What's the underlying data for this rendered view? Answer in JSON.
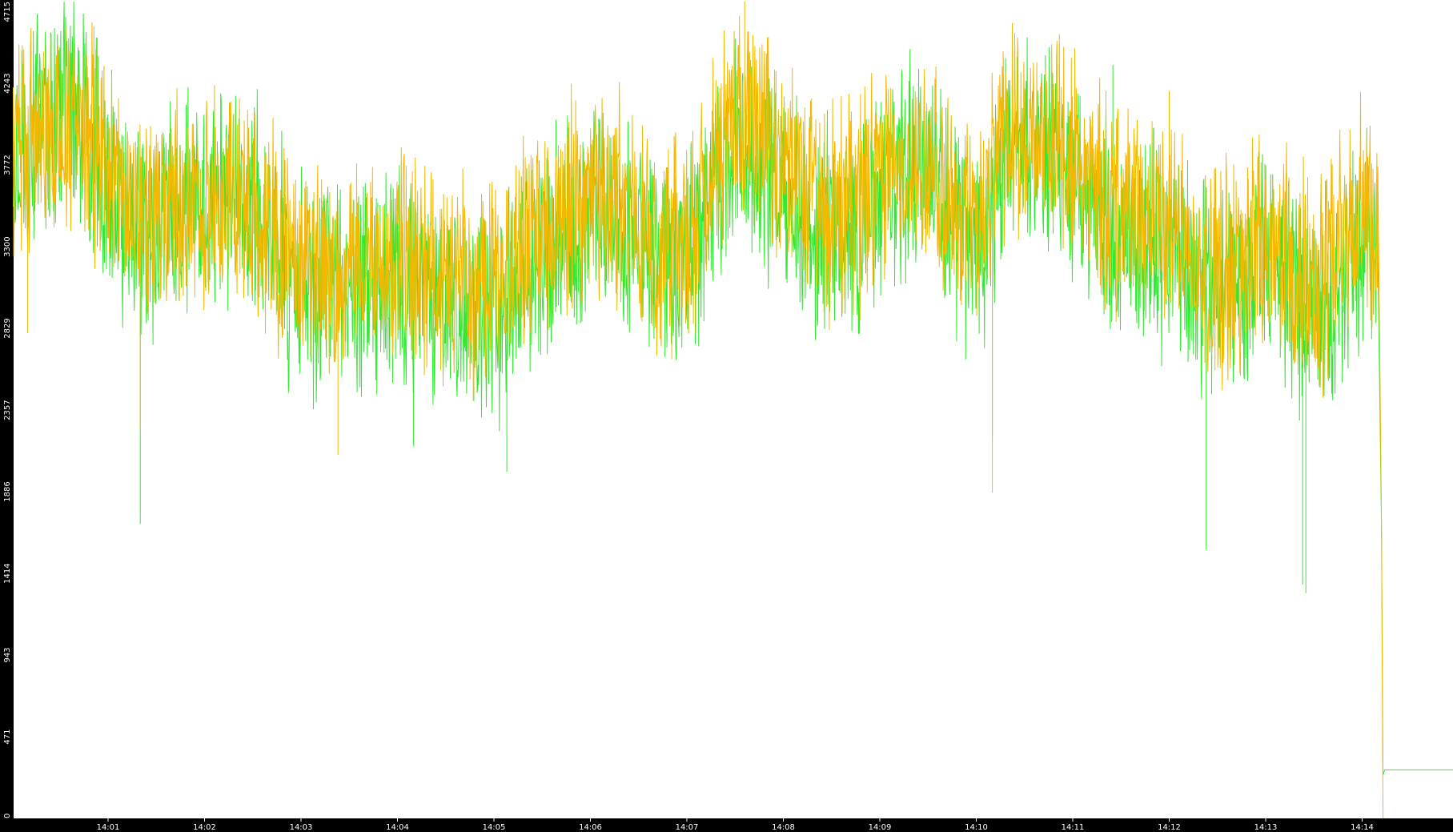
{
  "chart_data": {
    "type": "line",
    "title": "",
    "xlabel": "",
    "ylabel": "",
    "x_ticks": [
      "14:01",
      "14:02",
      "14:03",
      "14:04",
      "14:05",
      "14:06",
      "14:07",
      "14:08",
      "14:09",
      "14:10",
      "14:11",
      "14:12",
      "14:13",
      "14:14"
    ],
    "y_ticks": [
      "0",
      "471",
      "943",
      "1414",
      "1886",
      "2357",
      "2829",
      "3300",
      "3772",
      "4243",
      "4715"
    ],
    "ylim": [
      0,
      4715
    ],
    "xlim_minutes": [
      "14:00:01",
      "14:14:59"
    ],
    "grid": false,
    "legend": "none",
    "colors": {
      "background": "#ffffff",
      "frame": "#000000",
      "text": "#ffffff"
    },
    "series": [
      {
        "color": "#33e833",
        "trace": [
          [
            "14:00:01",
            3900
          ],
          [
            "14:00:40",
            4150
          ],
          [
            "14:01:00",
            3650
          ],
          [
            "14:01:20",
            3400
          ],
          [
            "14:01:40",
            3500
          ],
          [
            "14:02:00",
            3550
          ],
          [
            "14:02:30",
            3550
          ],
          [
            "14:03:00",
            3050
          ],
          [
            "14:03:30",
            3050
          ],
          [
            "14:04:00",
            3100
          ],
          [
            "14:04:30",
            3000
          ],
          [
            "14:05:00",
            2850
          ],
          [
            "14:05:30",
            3300
          ],
          [
            "14:06:00",
            3550
          ],
          [
            "14:06:30",
            3350
          ],
          [
            "14:07:00",
            3200
          ],
          [
            "14:07:30",
            3950
          ],
          [
            "14:08:00",
            3650
          ],
          [
            "14:08:30",
            3350
          ],
          [
            "14:09:00",
            3600
          ],
          [
            "14:09:30",
            3800
          ],
          [
            "14:10:00",
            3200
          ],
          [
            "14:10:20",
            3850
          ],
          [
            "14:10:50",
            3900
          ],
          [
            "14:11:00",
            3650
          ],
          [
            "14:11:30",
            3350
          ],
          [
            "14:12:00",
            3300
          ],
          [
            "14:12:30",
            3000
          ],
          [
            "14:13:00",
            3250
          ],
          [
            "14:13:30",
            2850
          ],
          [
            "14:14:00",
            3400
          ],
          [
            "14:14:10",
            3300
          ],
          [
            "14:14:12",
            1700
          ],
          [
            "14:14:13",
            250
          ],
          [
            "14:14:14",
            280
          ],
          [
            "14:14:59",
            280
          ]
        ],
        "spikes": [
          [
            "14:01:20",
            1700
          ],
          [
            "14:04:10",
            2150
          ],
          [
            "14:05:08",
            2000
          ],
          [
            "14:07:30",
            4500
          ],
          [
            "14:10:10",
            2200
          ],
          [
            "14:12:23",
            1550
          ],
          [
            "14:13:23",
            1350
          ],
          [
            "14:13:25",
            1300
          ],
          [
            "14:00:30",
            4450
          ],
          [
            "14:11:25",
            4350
          ]
        ]
      },
      {
        "color": "#f5b800",
        "trace": [
          [
            "14:00:01",
            3800
          ],
          [
            "14:00:40",
            4050
          ],
          [
            "14:01:00",
            3750
          ],
          [
            "14:01:20",
            3450
          ],
          [
            "14:01:40",
            3600
          ],
          [
            "14:02:00",
            3600
          ],
          [
            "14:02:30",
            3500
          ],
          [
            "14:03:00",
            3150
          ],
          [
            "14:03:30",
            3200
          ],
          [
            "14:04:00",
            3200
          ],
          [
            "14:04:30",
            3100
          ],
          [
            "14:05:00",
            3050
          ],
          [
            "14:05:30",
            3400
          ],
          [
            "14:06:00",
            3650
          ],
          [
            "14:06:30",
            3450
          ],
          [
            "14:07:00",
            3300
          ],
          [
            "14:07:30",
            4150
          ],
          [
            "14:08:00",
            3750
          ],
          [
            "14:08:30",
            3450
          ],
          [
            "14:09:00",
            3700
          ],
          [
            "14:09:30",
            3800
          ],
          [
            "14:10:00",
            3300
          ],
          [
            "14:10:20",
            3950
          ],
          [
            "14:10:50",
            4000
          ],
          [
            "14:11:00",
            3750
          ],
          [
            "14:11:30",
            3450
          ],
          [
            "14:12:00",
            3400
          ],
          [
            "14:12:30",
            3150
          ],
          [
            "14:13:00",
            3350
          ],
          [
            "14:13:30",
            3050
          ],
          [
            "14:14:00",
            3550
          ],
          [
            "14:14:10",
            3350
          ],
          [
            "14:14:12",
            1750
          ],
          [
            "14:14:13",
            0
          ]
        ],
        "spikes": [
          [
            "14:07:36",
            4715
          ],
          [
            "14:01:20",
            2250
          ],
          [
            "14:10:10",
            1880
          ],
          [
            "14:03:23",
            2100
          ],
          [
            "14:00:10",
            2800
          ],
          [
            "14:12:00",
            4200
          ]
        ]
      }
    ]
  }
}
